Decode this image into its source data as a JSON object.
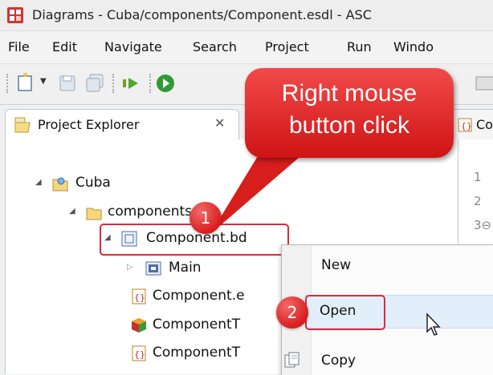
{
  "window": {
    "title": "Diagrams - Cuba/components/Component.esdl - ASC"
  },
  "menubar": {
    "items": [
      "File",
      "Edit",
      "Navigate",
      "Search",
      "Project",
      "Run",
      "Windo"
    ]
  },
  "toolbar": {
    "buttons": [
      "new-icon",
      "save-icon",
      "save-all-icon",
      "debug-icon",
      "run-icon"
    ]
  },
  "project_explorer": {
    "tab_label": "Project Explorer",
    "close_symbol": "✕"
  },
  "editor": {
    "tab_label": "Co",
    "line_numbers": [
      "1",
      "2",
      "3⊖"
    ]
  },
  "tree": {
    "project": "Cuba",
    "folder": "components",
    "selected": "Component.bd",
    "child": "Main",
    "items": [
      "Component.e",
      "ComponentT",
      "ComponentT"
    ]
  },
  "context_menu": {
    "items": [
      "New",
      "Open",
      "Copy"
    ]
  },
  "callout": {
    "line1": "Right mouse",
    "line2": "button click"
  },
  "badges": {
    "step1": "1",
    "step2": "2"
  },
  "colors": {
    "accent_red": "#e0283a",
    "selection_blue": "#e3eefb"
  }
}
